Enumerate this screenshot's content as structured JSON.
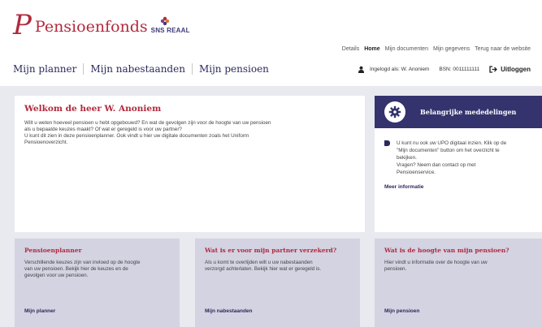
{
  "brand": {
    "name": "Pensioenfonds",
    "sub": "SNS REAAL",
    "mark": "P",
    "colors": {
      "primary": "#b1293d",
      "navy": "#34336e",
      "background": "#e9e9f0",
      "card": "#d3d3e2"
    }
  },
  "topnav": {
    "items": [
      "Details",
      "Home",
      "Mijn documenten",
      "Mijn gegevens",
      "Terug naar de website"
    ],
    "active": "Home"
  },
  "mainnav": {
    "items": [
      "Mijn planner",
      "Mijn nabestaanden",
      "Mijn pensioen"
    ]
  },
  "user": {
    "logged_in": "Ingelogd als: W. Anoniem",
    "bsn": "BSN: 0011111111",
    "logout": "Uitloggen"
  },
  "welcome": {
    "title": "Welkom de heer W. Anoniem",
    "line1": "Wilt u weten hoeveel pensioen u hebt opgebouwd? En wat de gevolgen zijn voor de hoogte van uw pensioen",
    "line2": "als u bepaalde keuzes maakt? Of wat er geregeld is voor uw partner?",
    "line3": "U kunt dit zien in deze pensioenplanner. Ook vindt u hier uw digitale documenten zoals het Uniform",
    "line4": "Pensioenoverzicht."
  },
  "notice": {
    "title": "Belangrijke mededelingen",
    "line1": "U kunt nu ook uw UPO digitaal inzien. Klik op de",
    "line2": "\"Mijn documenten\" button om het overzicht te",
    "line3": "bekijken.",
    "line4": "Vragen? Neem dan contact op met",
    "line5": "Pensioenservice.",
    "more": "Meer informatie"
  },
  "cards": [
    {
      "title": "Pensioenplanner",
      "line1": "Verschillende keuzes zijn van invloed op de hoogte",
      "line2": "van uw pensioen. Bekijk hier de keuzes en de",
      "line3": "gevolgen voor uw pensioen.",
      "link": "Mijn planner"
    },
    {
      "title": "Wat is er voor mijn partner verzekerd?",
      "line1": "Als u komt te overlijden wilt u uw nabestaanden",
      "line2": "verzorgd achterlaten. Bekijk hier wat er geregeld is.",
      "line3": "",
      "link": "Mijn nabestaanden"
    },
    {
      "title": "Wat is de hoogte van mijn pensioen?",
      "line1": "Hier vindt u informatie over de hoogte van uw",
      "line2": "pensioen.",
      "line3": "",
      "link": "Mijn pensioen"
    }
  ]
}
